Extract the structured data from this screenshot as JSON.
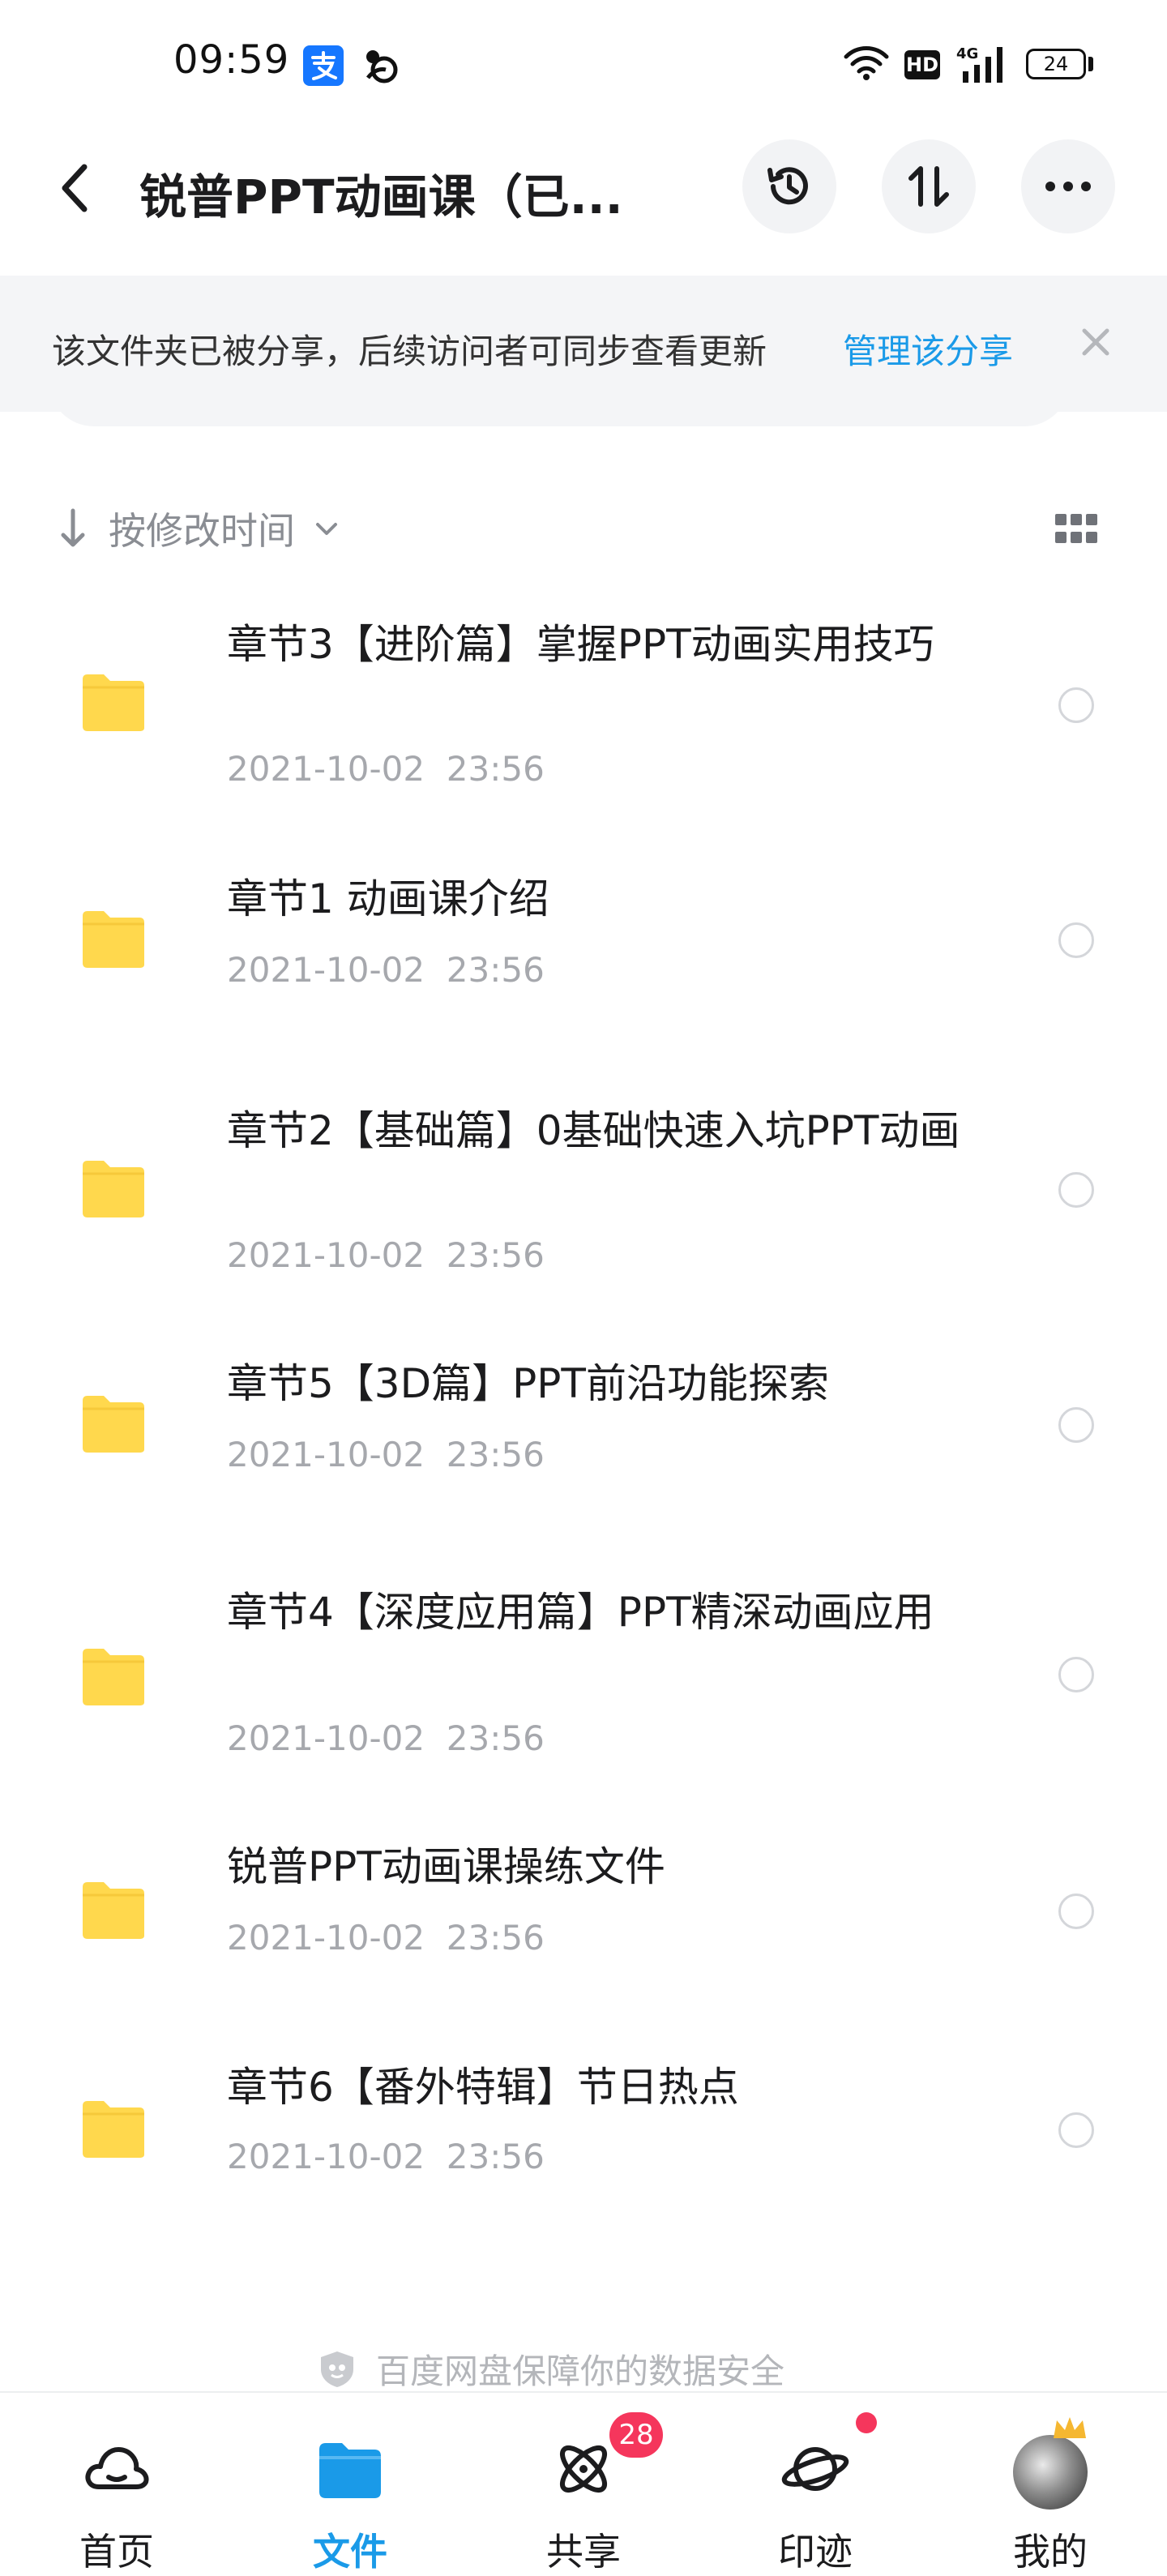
{
  "status_bar": {
    "time": "09:59",
    "hd_label": "HD",
    "network_label": "4G",
    "battery": "24"
  },
  "header": {
    "title": "锐普PPT动画课（已..."
  },
  "share_banner": {
    "message": "该文件夹已被分享，后续访问者可同步查看更新",
    "action": "管理该分享"
  },
  "sort": {
    "label": "按修改时间"
  },
  "files": [
    {
      "name": "章节3【进阶篇】掌握PPT动画实用技巧",
      "date": "2021-10-02  23:56"
    },
    {
      "name": "章节1 动画课介绍",
      "date": "2021-10-02  23:56"
    },
    {
      "name": "章节2【基础篇】0基础快速入坑PPT动画",
      "date": "2021-10-02  23:56"
    },
    {
      "name": "章节5【3D篇】PPT前沿功能探索",
      "date": "2021-10-02  23:56"
    },
    {
      "name": "章节4【深度应用篇】PPT精深动画应用",
      "date": "2021-10-02  23:56"
    },
    {
      "name": "锐普PPT动画课操练文件",
      "date": "2021-10-02  23:56"
    },
    {
      "name": "章节6【番外特辑】节日热点",
      "date": "2021-10-02  23:56"
    }
  ],
  "footer_note": "百度网盘保障你的数据安全",
  "tabs": [
    {
      "label": "首页",
      "icon": "cloud-home-icon"
    },
    {
      "label": "文件",
      "icon": "folder-tab-icon",
      "active": true
    },
    {
      "label": "共享",
      "icon": "atom-share-icon"
    },
    {
      "label": "印迹",
      "icon": "planet-icon"
    },
    {
      "label": "我的",
      "icon": "avatar"
    }
  ],
  "badges": {
    "share_count": "28"
  },
  "colors": {
    "accent": "#1a9ae8",
    "folder": "#ffd84d",
    "badge": "#f5365c",
    "banner_bg": "#f4f5f7"
  }
}
